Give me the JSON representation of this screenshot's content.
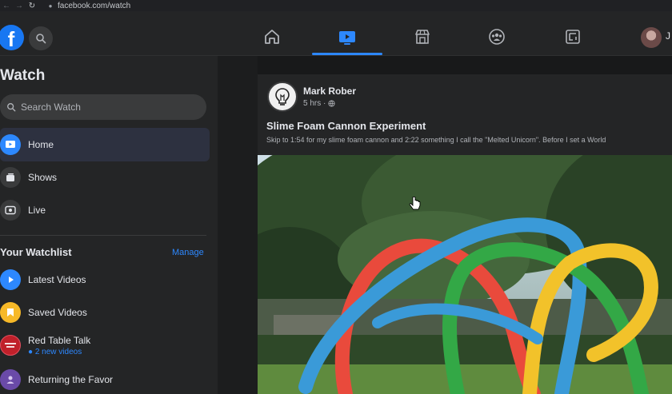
{
  "browser": {
    "url": "facebook.com/watch"
  },
  "topnav": {
    "logo_letter": "f",
    "profile_initial": "J"
  },
  "sidebar": {
    "title": "Watch",
    "search_placeholder": "Search Watch",
    "items": [
      {
        "label": "Home",
        "icon": "play-icon"
      },
      {
        "label": "Shows",
        "icon": "shows-icon"
      },
      {
        "label": "Live",
        "icon": "live-icon"
      }
    ],
    "watchlist": {
      "title": "Your Watchlist",
      "manage": "Manage",
      "items": [
        {
          "label": "Latest Videos",
          "sub": "",
          "icon": "play-icon"
        },
        {
          "label": "Saved Videos",
          "sub": "",
          "icon": "bookmark-icon"
        },
        {
          "label": "Red Table Talk",
          "sub": "2 new videos",
          "icon": "avatar"
        },
        {
          "label": "Returning the Favor",
          "sub": "",
          "icon": "avatar"
        }
      ]
    }
  },
  "post": {
    "author": "Mark Rober",
    "time": "5 hrs",
    "title": "Slime Foam Cannon Experiment",
    "description": "Skip to 1:54 for my slime foam cannon and 2:22 something I call the \"Melted Unicorn\". Before I set a World"
  },
  "colors": {
    "accent": "#2d88ff",
    "background": "#18191a",
    "surface": "#242526"
  }
}
